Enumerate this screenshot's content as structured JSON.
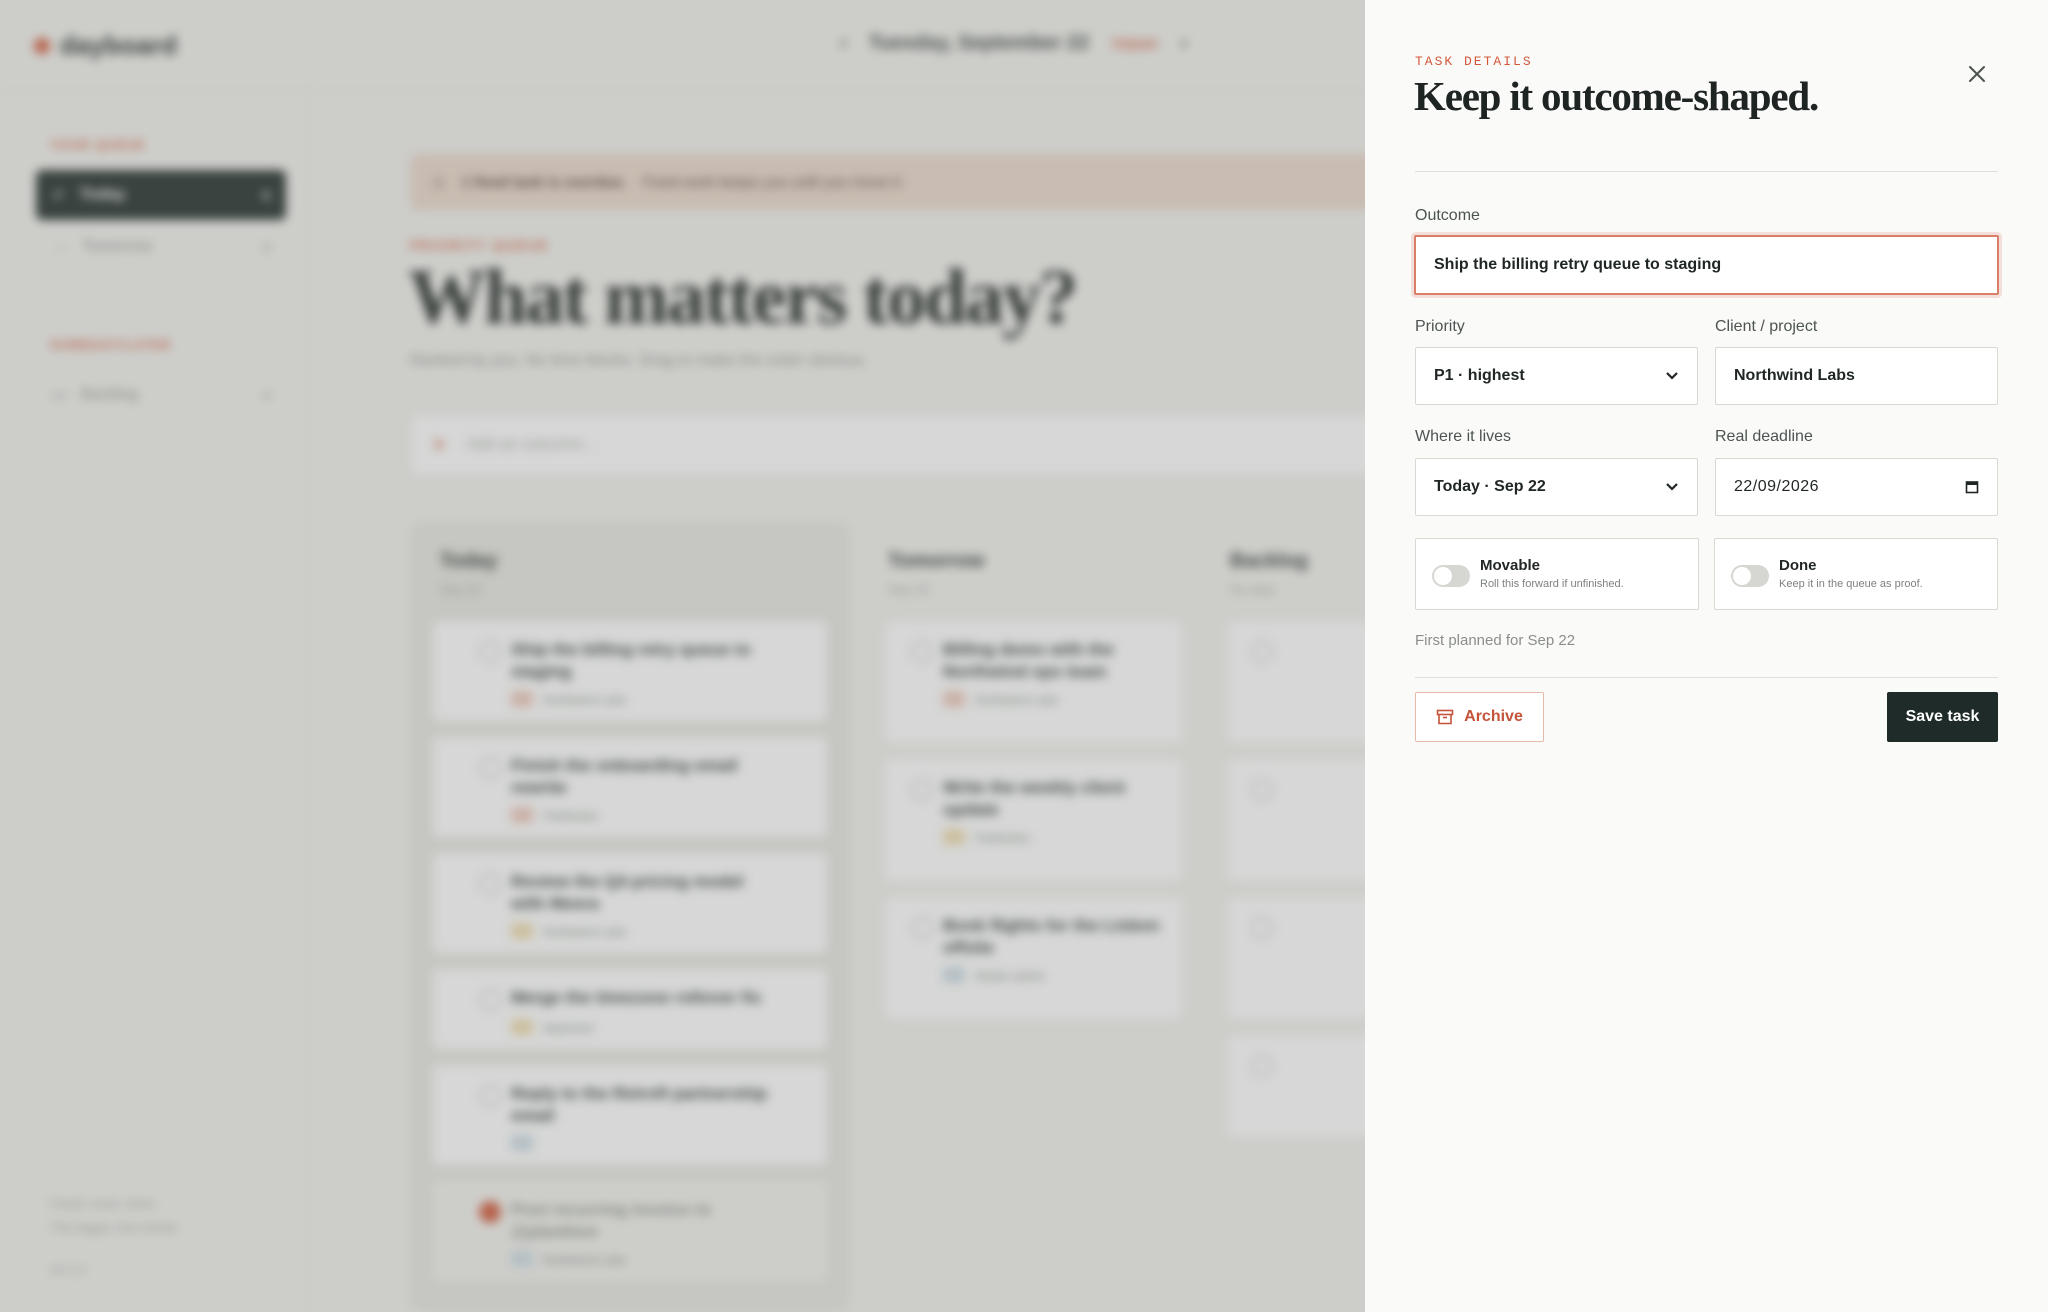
{
  "background": {
    "logo": "dayboard",
    "date": "Tuesday, September 22",
    "today_pill": "TODAY",
    "sidebar": {
      "section_queue": "YOUR QUEUE",
      "items": [
        {
          "label": "Today",
          "count": "6"
        },
        {
          "label": "Tomorrow",
          "count": "3"
        }
      ],
      "section_someday": "SOMEDAY/LATER",
      "backlog": {
        "label": "Backlog",
        "count": "4"
      },
      "footer_line1": "Fewer, truer, done.",
      "footer_line2": "The bigger, the harder.",
      "version": "v0.1.0"
    },
    "banner": "1 fixed task is overdue.",
    "banner_sub": "Fixed work keeps you until you move it.",
    "kicker": "PRIORITY QUEUE",
    "title": "What matters today?",
    "subtitle": "Ranked by you. No time blocks. Drag to make the order obvious.",
    "add_placeholder": "Add an outcome…",
    "columns": [
      {
        "title": "Today",
        "date": "Sep 22"
      },
      {
        "title": "Tomorrow",
        "date": "Sep 23"
      },
      {
        "title": "Backlog",
        "date": "No date"
      }
    ],
    "today_cards": [
      {
        "title": "Ship the billing retry queue to staging",
        "meta": "Northwind Labs"
      },
      {
        "title": "Finish the onboarding email rewrite",
        "meta": "Fieldnotes"
      },
      {
        "title": "Review the Q4 pricing model with Meera",
        "meta": "Northwind Labs"
      },
      {
        "title": "Merge the timezone rollover fix",
        "meta": "dayboard"
      },
      {
        "title": "Reply to the Retroft partnership email",
        "meta": ""
      },
      {
        "title": "Post recurring invoice to @plankton",
        "meta": "Northwind Labs"
      }
    ],
    "tomorrow_cards": [
      {
        "title": "Billing demo with the Northwind ops team",
        "meta": "Northwind Labs"
      },
      {
        "title": "Write the weekly client update",
        "meta": "Fieldnotes"
      },
      {
        "title": "Book flights for the Lisbon offsite",
        "meta": "Studio admin"
      }
    ]
  },
  "drawer": {
    "kicker": "TASK DETAILS",
    "title": "Keep it outcome-shaped.",
    "outcome": {
      "label": "Outcome",
      "value": "Ship the billing retry queue to staging"
    },
    "priority": {
      "label": "Priority",
      "value": "P1 · highest"
    },
    "client": {
      "label": "Client / project",
      "value": "Northwind Labs"
    },
    "where": {
      "label": "Where it lives",
      "value": "Today · Sep 22"
    },
    "deadline": {
      "label": "Real deadline",
      "value": "22/09/2026"
    },
    "movable": {
      "label": "Movable",
      "desc": "Roll this forward if unfinished.",
      "on": false
    },
    "done": {
      "label": "Done",
      "desc": "Keep it in the queue as proof.",
      "on": false
    },
    "note": "First planned for Sep 22",
    "archive_label": "Archive",
    "save_label": "Save task"
  },
  "colors": {
    "accent": "#d3583a",
    "dark": "#1f2b28",
    "drawer_bg": "#fafaf9"
  }
}
